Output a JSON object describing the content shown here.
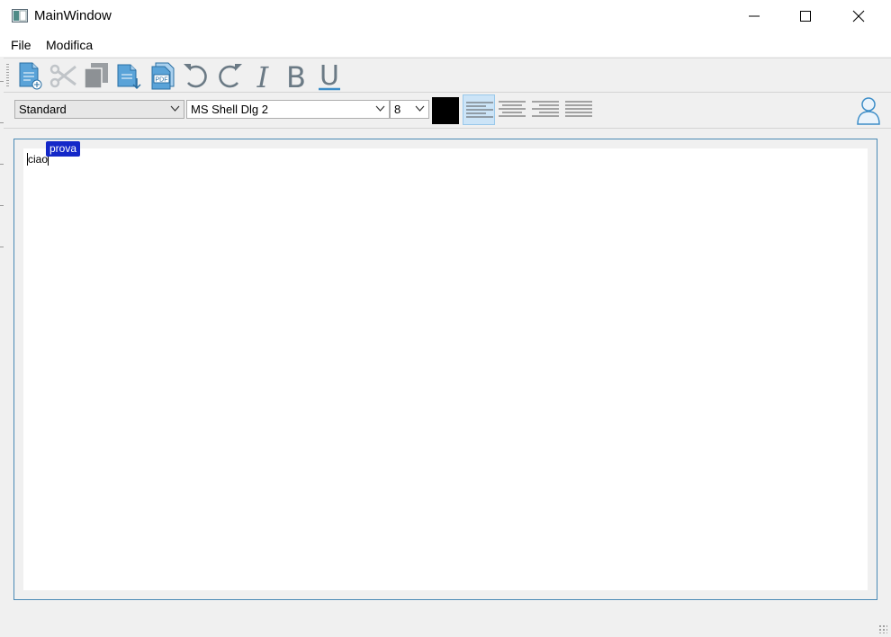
{
  "window": {
    "title": "MainWindow"
  },
  "menu": {
    "items": [
      "File",
      "Modifica"
    ]
  },
  "toolbar": {
    "icons": [
      "new-document-icon",
      "cut-icon",
      "copy-icon",
      "export-document-icon",
      "export-pdf-icon",
      "undo-icon",
      "redo-icon",
      "italic-icon",
      "bold-icon",
      "underline-icon"
    ],
    "pdf_label": "PDF",
    "italic_glyph": "I",
    "bold_glyph": "B",
    "underline_glyph": "U"
  },
  "format_bar": {
    "style_value": "Standard",
    "font_value": "MS Shell Dlg 2",
    "size_value": "8",
    "text_color": "#000000",
    "active_alignment": "left"
  },
  "editor": {
    "content": "ciao",
    "remote_cursor_label": "prova",
    "remote_cursor_color": "#1428c8"
  },
  "colors": {
    "accent": "#4a8ab5",
    "icon_blue": "#3c8dc8",
    "icon_gray": "#6b7a85"
  }
}
